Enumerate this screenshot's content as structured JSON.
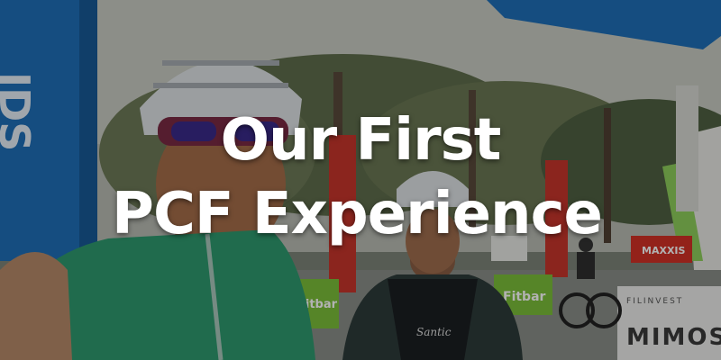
{
  "title": {
    "line1": "Our First",
    "line2": "PCF Experience"
  },
  "signage": {
    "arch_text": "IDS",
    "fitbar_a": "Fitbar",
    "fitbar_b": "Fitbar",
    "maxxis": "MAXXIS",
    "filinvest": "FILINVEST",
    "mimosa": "MIMOS",
    "jersey_script": "Santic"
  },
  "colors": {
    "overlay": "#000000",
    "title": "#ffffff",
    "arch_blue": "#1f6fb8",
    "jersey_green": "#2e9a6f",
    "helmet_white": "#dfe3e6",
    "banner_red": "#c7362b",
    "fitbar_green": "#7cbf3a"
  }
}
